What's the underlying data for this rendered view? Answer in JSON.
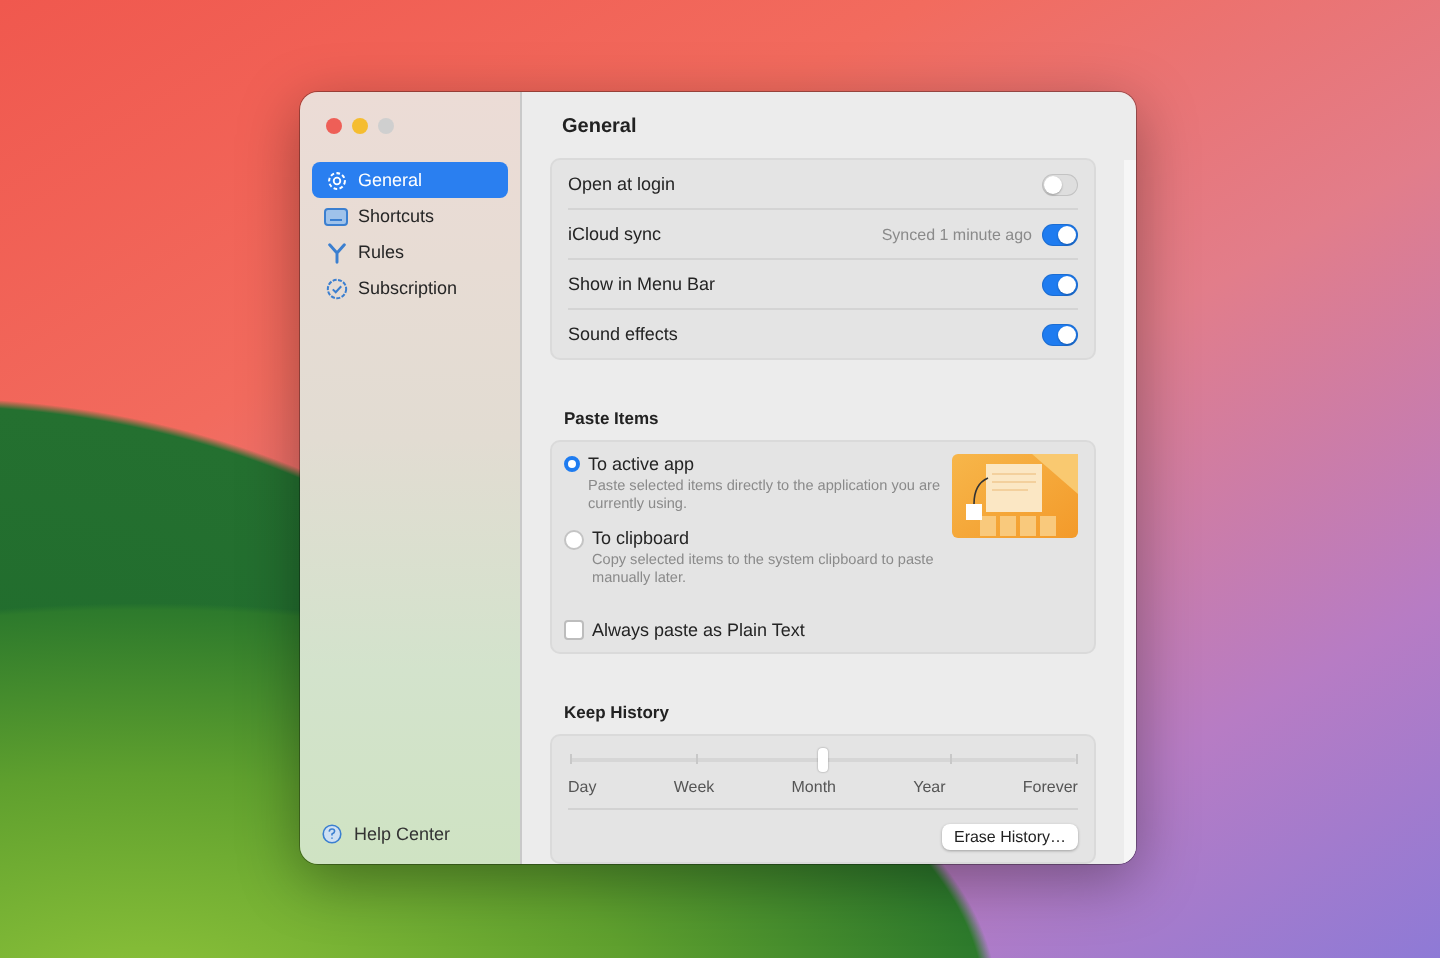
{
  "sidebar": {
    "items": [
      {
        "label": "General",
        "selected": true
      },
      {
        "label": "Shortcuts",
        "selected": false
      },
      {
        "label": "Rules",
        "selected": false
      },
      {
        "label": "Subscription",
        "selected": false
      }
    ],
    "footer": "Help Center"
  },
  "title": "General",
  "general": [
    {
      "label": "Open at login",
      "on": false
    },
    {
      "label": "iCloud sync",
      "status": "Synced 1 minute ago",
      "on": true
    },
    {
      "label": "Show in Menu Bar",
      "on": true
    },
    {
      "label": "Sound effects",
      "on": true
    }
  ],
  "paste_items": {
    "title": "Paste Items",
    "options": [
      {
        "label": "To active app",
        "description": "Paste selected items directly to the application you are currently using.",
        "selected": true
      },
      {
        "label": "To clipboard",
        "description": "Copy selected items to the system clipboard to paste manually later.",
        "selected": false
      }
    ],
    "plain_text": {
      "label": "Always paste as Plain Text",
      "checked": false
    }
  },
  "keep_history": {
    "title": "Keep History",
    "stops": [
      "Day",
      "Week",
      "Month",
      "Year",
      "Forever"
    ],
    "level": 0.5,
    "button": "Erase History…"
  }
}
